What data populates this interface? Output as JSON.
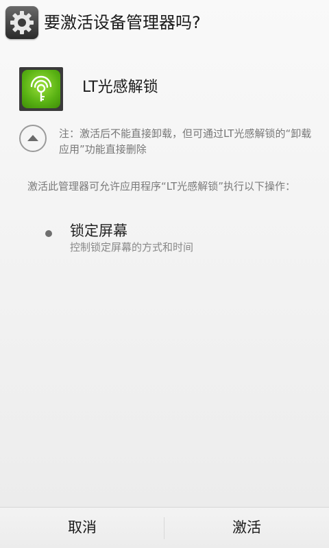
{
  "dialog": {
    "title": "要激活设备管理器吗?"
  },
  "app": {
    "name": "LT光感解锁"
  },
  "note": {
    "text": "注：激活后不能直接卸载，但可通过LT光感解锁的“卸载应用”功能直接删除"
  },
  "description": "激活此管理器可允许应用程序“LT光感解锁”执行以下操作：",
  "policies": [
    {
      "title": "锁定屏幕",
      "description": "控制锁定屏幕的方式和时间"
    }
  ],
  "buttons": {
    "cancel": "取消",
    "activate": "激活"
  },
  "icons": {
    "title": "settings-gear-icon",
    "app": "light-key-icon",
    "expand": "chevron-up-icon",
    "bullet": "bullet-dot-icon"
  },
  "colors": {
    "app_icon_green": "#58b113"
  }
}
